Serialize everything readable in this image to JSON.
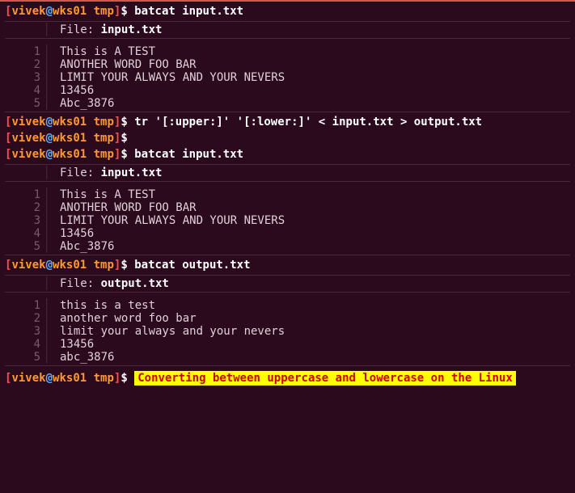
{
  "prompt": {
    "lb": "[",
    "user": "vivek",
    "at": "@",
    "host": "wks01",
    "cwd": "tmp",
    "rb": "]",
    "sym": "$"
  },
  "cmds": {
    "c1": "batcat input.txt",
    "c2": "tr '[:upper:]' '[:lower:]' < input.txt > output.txt",
    "c3": "",
    "c4": "batcat input.txt",
    "c5": "batcat output.txt"
  },
  "bat": {
    "file_label": "File: ",
    "file1": "input.txt",
    "file2": "output.txt",
    "lines1": [
      "This is A TEST",
      "ANOTHER WORD FOO BAR",
      "LIMIT YOUR ALWAYS AND YOUR NEVERS",
      "13456",
      "Abc_3876"
    ],
    "lines2": [
      "this is a test",
      "another word foo bar",
      "limit your always and your nevers",
      "13456",
      "abc_3876"
    ],
    "nums": [
      "1",
      "2",
      "3",
      "4",
      "5"
    ]
  },
  "highlight": "Converting between uppercase and lowercase on the Linux"
}
